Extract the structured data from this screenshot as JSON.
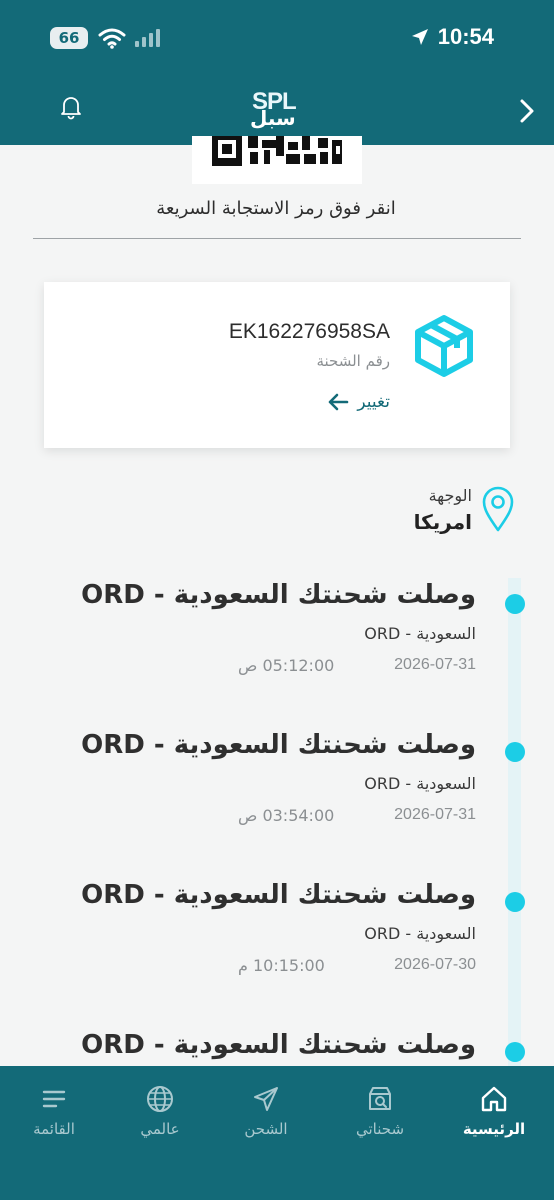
{
  "status_bar": {
    "time": "10:54",
    "battery": "66"
  },
  "header": {
    "logo_latin": "SPL",
    "logo_arabic": "سبل"
  },
  "qr": {
    "hint": "انقر فوق رمز الاستجابة السريعة"
  },
  "shipment_card": {
    "tracking_number": "EK162276958SA",
    "tracking_label": "رقم الشحنة",
    "change_label": "تغيير"
  },
  "destination": {
    "label": "الوجهة",
    "value": "امريكا"
  },
  "timeline": [
    {
      "title": "وصلت شحنتك السعودية - ORD",
      "subtitle": "السعودية - ORD",
      "date": "2026-07-31",
      "time": "05:12:00 ص"
    },
    {
      "title": "وصلت شحنتك السعودية - ORD",
      "subtitle": "السعودية - ORD",
      "date": "2026-07-31",
      "time": "03:54:00 ص"
    },
    {
      "title": "وصلت شحنتك السعودية - ORD",
      "subtitle": "السعودية - ORD",
      "date": "2026-07-30",
      "time": "10:15:00 م"
    },
    {
      "title": "وصلت شحنتك السعودية - ORD"
    }
  ],
  "bottom_nav": [
    {
      "label": "الرئيسية",
      "icon": "home-icon",
      "active": true
    },
    {
      "label": "شحناتي",
      "icon": "shipments-icon",
      "active": false
    },
    {
      "label": "الشحن",
      "icon": "send-icon",
      "active": false
    },
    {
      "label": "عالمي",
      "icon": "globe-icon",
      "active": false
    },
    {
      "label": "القائمة",
      "icon": "menu-icon",
      "active": false
    }
  ],
  "colors": {
    "primary": "#136a78",
    "accent": "#1ccde6",
    "background": "#f4f5f5"
  }
}
